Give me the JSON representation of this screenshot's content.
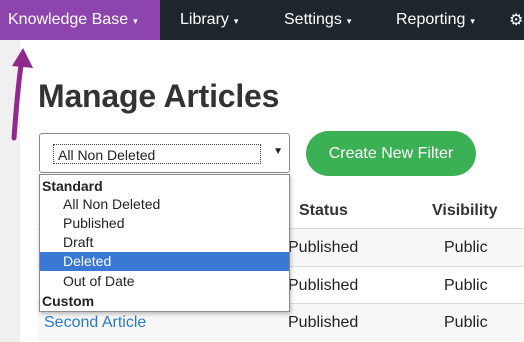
{
  "nav": {
    "items": [
      {
        "label": "Knowledge Base"
      },
      {
        "label": "Library"
      },
      {
        "label": "Settings"
      },
      {
        "label": "Reporting"
      },
      {
        "label": "⚙"
      }
    ],
    "caret": "▾"
  },
  "page": {
    "title": "Manage Articles"
  },
  "filter": {
    "selected_value": "All Non Deleted",
    "groups": [
      {
        "label": "Standard",
        "options": [
          "All Non Deleted",
          "Published",
          "Draft",
          "Deleted",
          "Out of Date"
        ]
      },
      {
        "label": "Custom",
        "options": []
      }
    ],
    "highlighted_option": "Deleted"
  },
  "create_filter_button": "Create New Filter",
  "table": {
    "headers": [
      "Status",
      "Visibility"
    ],
    "rows": [
      {
        "name": "",
        "status": "Published",
        "visibility": "Public"
      },
      {
        "name": "",
        "status": "Published",
        "visibility": "Public"
      },
      {
        "name": "Second Article",
        "status": "Published",
        "visibility": "Public"
      }
    ]
  },
  "colors": {
    "nav_bg": "#1d252d",
    "nav_active": "#8e44ad",
    "button_green": "#3cb054",
    "option_highlight": "#3a78d6",
    "link_blue": "#2a7ac7",
    "annotation_arrow": "#8e2a8e"
  }
}
